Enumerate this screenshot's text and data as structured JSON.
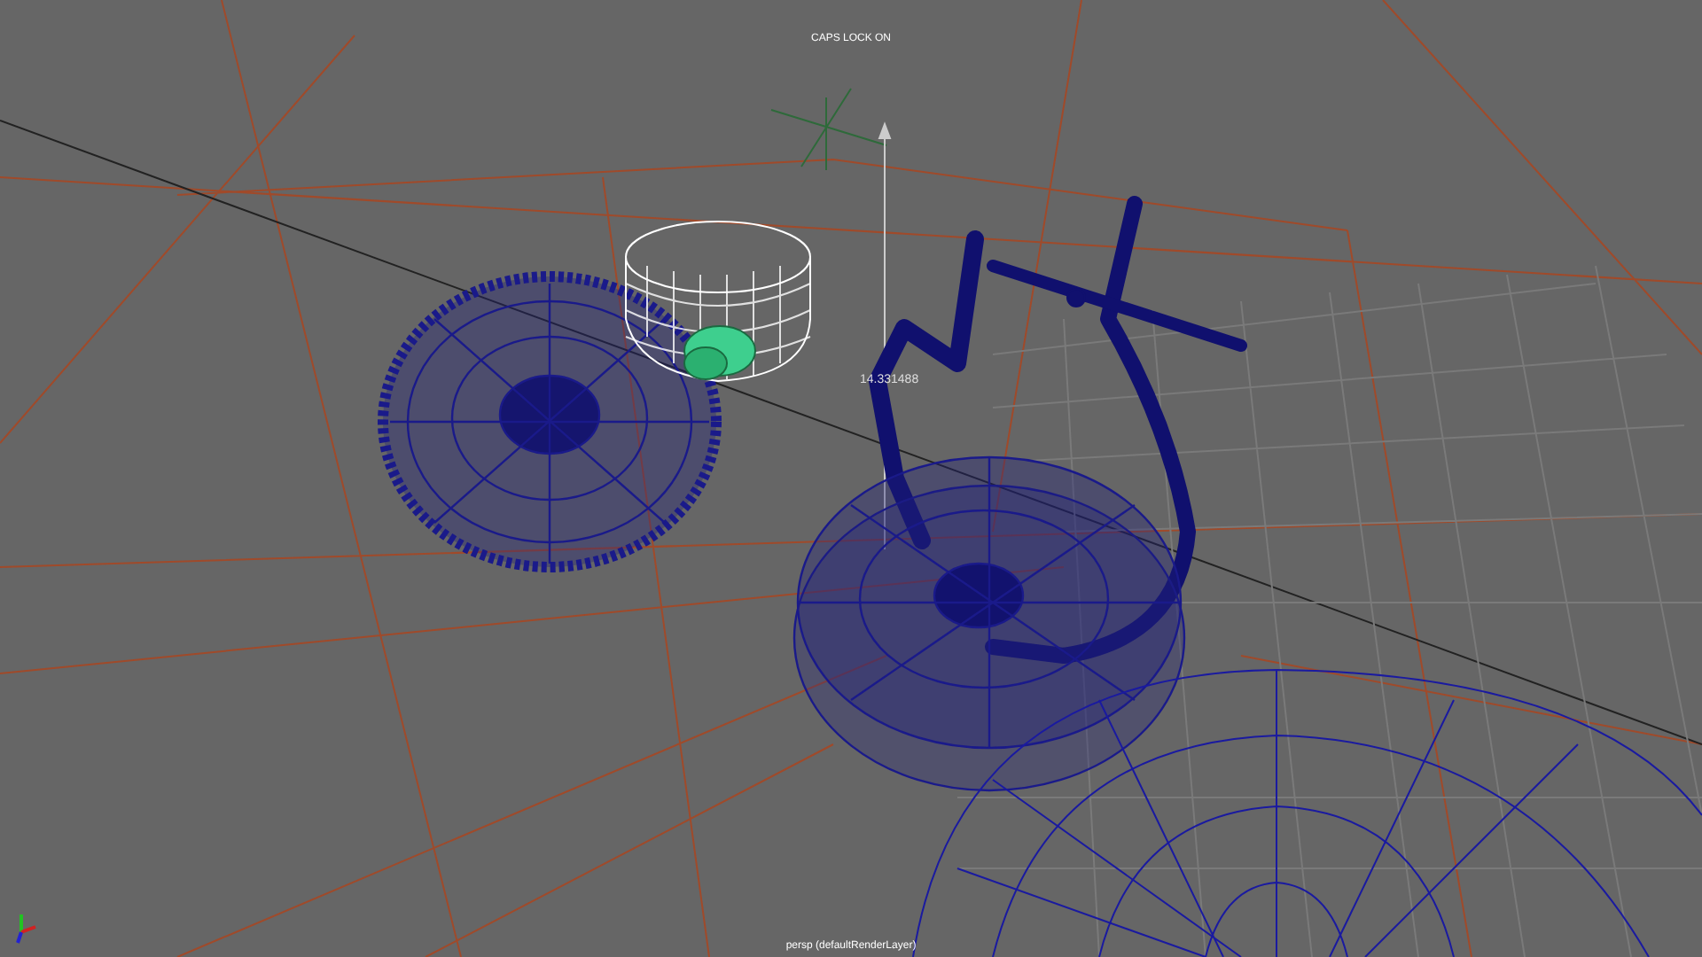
{
  "viewport": {
    "hud_message": "CAPS LOCK ON",
    "measurement": "14.331488",
    "camera_label": "persp (defaultRenderLayer)"
  }
}
